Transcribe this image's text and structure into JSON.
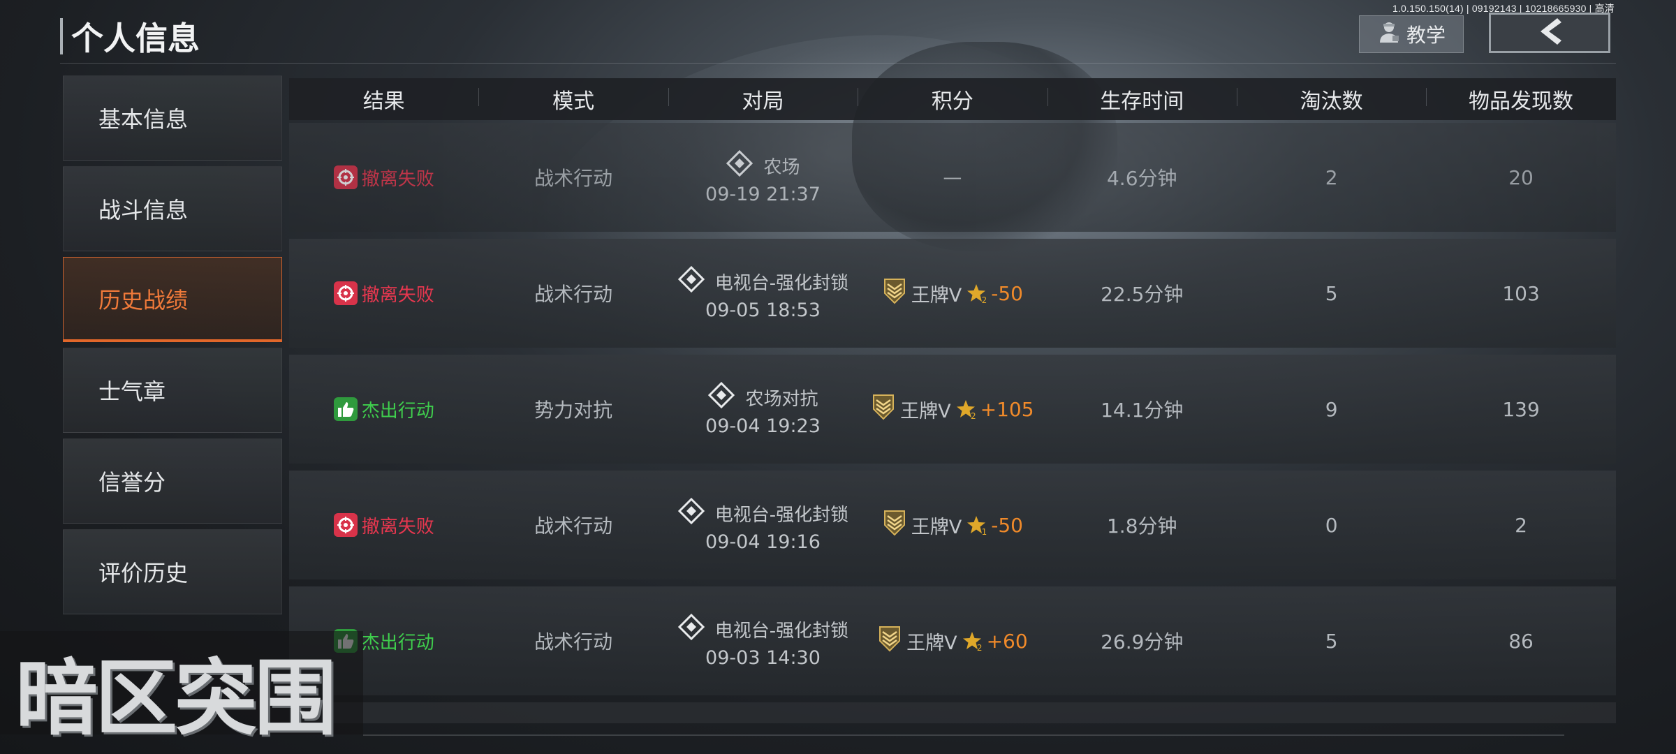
{
  "build_info": "1.0.150.150(14) | 09192143 | 10218665930 | 高清",
  "header": {
    "title": "个人信息",
    "tutorial_label": "教学"
  },
  "sidebar": {
    "items": [
      {
        "label": "基本信息",
        "active": false
      },
      {
        "label": "战斗信息",
        "active": false
      },
      {
        "label": "历史战绩",
        "active": true
      },
      {
        "label": "士气章",
        "active": false
      },
      {
        "label": "信誉分",
        "active": false
      },
      {
        "label": "评价历史",
        "active": false
      }
    ]
  },
  "table": {
    "columns": [
      "结果",
      "模式",
      "对局",
      "积分",
      "生存时间",
      "淘汰数",
      "物品发现数"
    ],
    "rows": [
      {
        "result": "撤离失败",
        "result_type": "fail",
        "mode": "战术行动",
        "map": "农场",
        "date": "09-19 21:37",
        "score": "—",
        "rank": "",
        "star_level": "",
        "delta": "",
        "survival": "4.6分钟",
        "eliminations": "2",
        "items_found": "20"
      },
      {
        "result": "撤离失败",
        "result_type": "fail",
        "mode": "战术行动",
        "map": "电视台-强化封锁",
        "date": "09-05 18:53",
        "score": "",
        "rank": "王牌V",
        "star_level": "2",
        "delta": "-50",
        "survival": "22.5分钟",
        "eliminations": "5",
        "items_found": "103"
      },
      {
        "result": "杰出行动",
        "result_type": "win",
        "mode": "势力对抗",
        "map": "农场对抗",
        "date": "09-04 19:23",
        "score": "",
        "rank": "王牌V",
        "star_level": "2",
        "delta": "+105",
        "survival": "14.1分钟",
        "eliminations": "9",
        "items_found": "139"
      },
      {
        "result": "撤离失败",
        "result_type": "fail",
        "mode": "战术行动",
        "map": "电视台-强化封锁",
        "date": "09-04 19:16",
        "score": "",
        "rank": "王牌V",
        "star_level": "1",
        "delta": "-50",
        "survival": "1.8分钟",
        "eliminations": "0",
        "items_found": "2"
      },
      {
        "result": "杰出行动",
        "result_type": "win",
        "mode": "战术行动",
        "map": "电视台-强化封锁",
        "date": "09-03 14:30",
        "score": "",
        "rank": "王牌V",
        "star_level": "2",
        "delta": "+60",
        "survival": "26.9分钟",
        "eliminations": "5",
        "items_found": "86"
      }
    ]
  },
  "logo": {
    "text": "暗区突围"
  },
  "colors": {
    "accent_orange": "#e2672a",
    "fail_red": "#e8374f",
    "win_green": "#3fce4d",
    "delta_orange": "#f08a2a",
    "star_gold": "#e0a82a"
  },
  "icons": {
    "fail_icon": "crosshair-icon",
    "win_icon": "thumbs-up-icon",
    "map_icon": "diamond-marker-icon",
    "rank_icon": "rank-chevron-badge-icon",
    "star_icon": "star-icon",
    "back_icon": "chevron-left-icon",
    "tutorial_icon": "instructor-icon"
  }
}
